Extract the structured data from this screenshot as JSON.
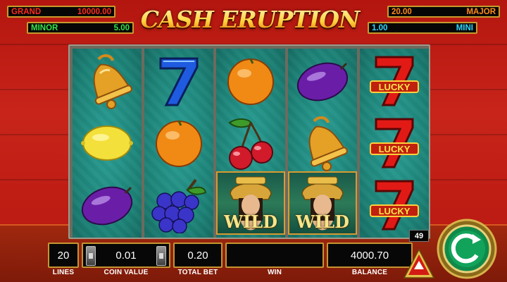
{
  "title": "CASH ERUPTION",
  "jackpots": {
    "grand": {
      "label": "GRAND",
      "value": "10000.00"
    },
    "minor": {
      "label": "MINOR",
      "value": "5.00"
    },
    "major": {
      "label": "MAJOR",
      "value": "20.00"
    },
    "mini": {
      "label": "MINI",
      "value": "1.00"
    }
  },
  "reels": [
    [
      "bell-icon",
      "lemon-icon",
      "plum-icon"
    ],
    [
      "seven-blue-icon",
      "orange-icon",
      "grapes-icon"
    ],
    [
      "orange-icon",
      "cherry-icon",
      "wild-symbol"
    ],
    [
      "plum-icon",
      "bell-icon",
      "wild-symbol"
    ],
    [
      "lucky-seven-icon",
      "lucky-seven-icon",
      "lucky-seven-icon"
    ]
  ],
  "symbols": {
    "lucky_text": "LUCKY",
    "wild_text": "WILD"
  },
  "bottom_bar": {
    "lines": {
      "value": "20",
      "label": "LINES"
    },
    "coin_value": {
      "value": "0.01",
      "label": "COIN VALUE"
    },
    "total_bet": {
      "value": "0.20",
      "label": "TOTAL BET"
    },
    "win": {
      "value": "",
      "label": "WIN"
    },
    "balance": {
      "value": "4000.70",
      "label": "BALANCE"
    }
  },
  "spin_count": "49",
  "colors": {
    "grand": "#ff2b1d",
    "minor": "#34e64a",
    "major": "#ff8a1a",
    "mini": "#2fd8ff",
    "reel_bg": "#1d8277",
    "frame_gold": "#c59532"
  }
}
